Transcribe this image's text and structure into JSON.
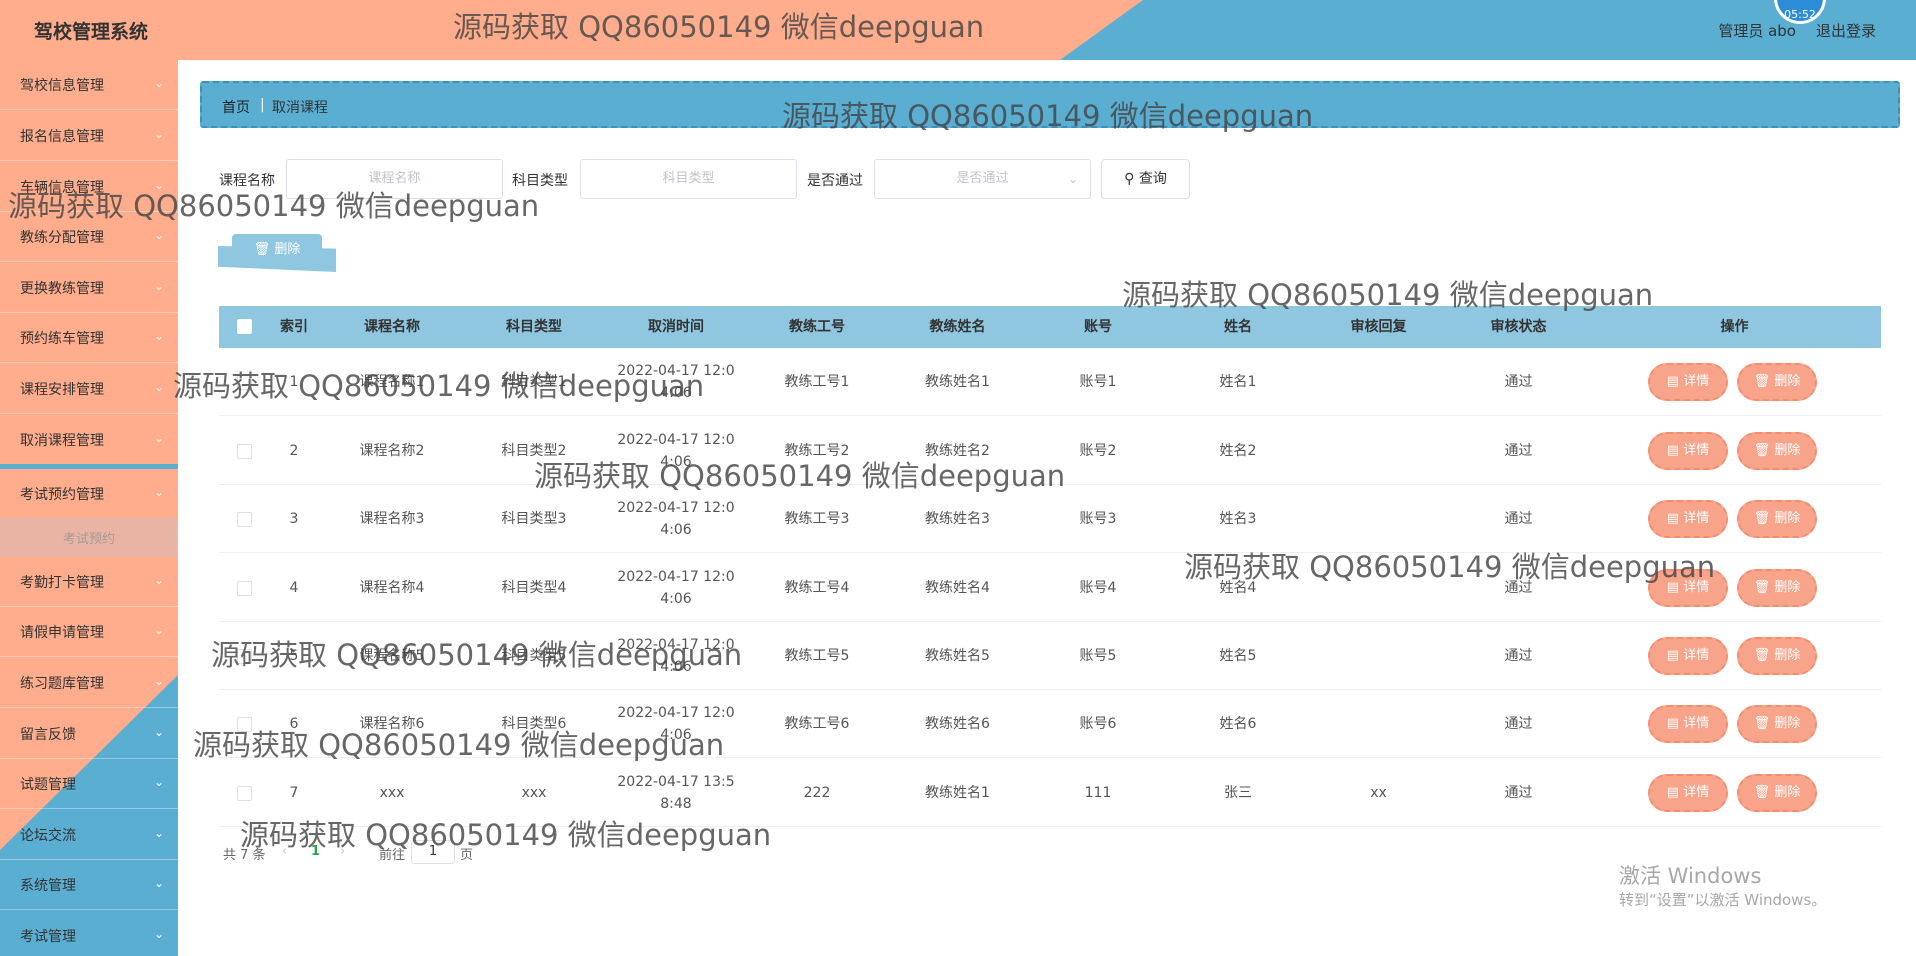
{
  "header": {
    "brand": "驾校管理系统",
    "user": "管理员 abo",
    "logout": "退出登录",
    "clock": "05:52"
  },
  "sidebar": {
    "items": [
      {
        "label": "驾校信息管理"
      },
      {
        "label": "报名信息管理"
      },
      {
        "label": "车辆信息管理"
      },
      {
        "label": "教练分配管理"
      },
      {
        "label": "更换教练管理"
      },
      {
        "label": "预约练车管理"
      },
      {
        "label": "课程安排管理"
      },
      {
        "label": "取消课程管理"
      },
      {
        "label": "考试预约管理"
      },
      {
        "label": "考勤打卡管理"
      },
      {
        "label": "请假申请管理"
      },
      {
        "label": "练习题库管理"
      },
      {
        "label": "留言反馈"
      },
      {
        "label": "试题管理"
      },
      {
        "label": "论坛交流"
      },
      {
        "label": "系统管理"
      },
      {
        "label": "考试管理"
      }
    ],
    "sub_item": "考试预约"
  },
  "breadcrumb": {
    "home": "首页",
    "separator": "|",
    "current": "取消课程"
  },
  "search": {
    "course_label": "课程名称",
    "course_placeholder": "课程名称",
    "subject_label": "科目类型",
    "subject_placeholder": "科目类型",
    "pass_label": "是否通过",
    "pass_placeholder": "是否通过",
    "query_button": "查询"
  },
  "toolbar": {
    "delete_button": "删除"
  },
  "table": {
    "columns": [
      "索引",
      "课程名称",
      "科目类型",
      "取消时间",
      "教练工号",
      "教练姓名",
      "账号",
      "姓名",
      "审核回复",
      "审核状态",
      "操作"
    ],
    "rows": [
      {
        "index": "1",
        "course": "课程名称1",
        "subject": "科目类型1",
        "time1": "2022-04-17 12:0",
        "time2": "4:06",
        "coach_no": "教练工号1",
        "coach_name": "教练姓名1",
        "account": "账号1",
        "name": "姓名1",
        "reply": "",
        "status": "通过"
      },
      {
        "index": "2",
        "course": "课程名称2",
        "subject": "科目类型2",
        "time1": "2022-04-17 12:0",
        "time2": "4:06",
        "coach_no": "教练工号2",
        "coach_name": "教练姓名2",
        "account": "账号2",
        "name": "姓名2",
        "reply": "",
        "status": "通过"
      },
      {
        "index": "3",
        "course": "课程名称3",
        "subject": "科目类型3",
        "time1": "2022-04-17 12:0",
        "time2": "4:06",
        "coach_no": "教练工号3",
        "coach_name": "教练姓名3",
        "account": "账号3",
        "name": "姓名3",
        "reply": "",
        "status": "通过"
      },
      {
        "index": "4",
        "course": "课程名称4",
        "subject": "科目类型4",
        "time1": "2022-04-17 12:0",
        "time2": "4:06",
        "coach_no": "教练工号4",
        "coach_name": "教练姓名4",
        "account": "账号4",
        "name": "姓名4",
        "reply": "",
        "status": "通过"
      },
      {
        "index": "5",
        "course": "课程名称5",
        "subject": "科目类型5",
        "time1": "2022-04-17 12:0",
        "time2": "4:06",
        "coach_no": "教练工号5",
        "coach_name": "教练姓名5",
        "account": "账号5",
        "name": "姓名5",
        "reply": "",
        "status": "通过"
      },
      {
        "index": "6",
        "course": "课程名称6",
        "subject": "科目类型6",
        "time1": "2022-04-17 12:0",
        "time2": "4:06",
        "coach_no": "教练工号6",
        "coach_name": "教练姓名6",
        "account": "账号6",
        "name": "姓名6",
        "reply": "",
        "status": "通过"
      },
      {
        "index": "7",
        "course": "xxx",
        "subject": "xxx",
        "time1": "2022-04-17 13:5",
        "time2": "8:48",
        "coach_no": "222",
        "coach_name": "教练姓名1",
        "account": "111",
        "name": "张三",
        "reply": "xx",
        "status": "通过"
      }
    ],
    "detail_button": "详情",
    "delete_button": "删除"
  },
  "pagination": {
    "total": "共 7 条",
    "current_page": "1",
    "goto_label": "前往",
    "goto_value": "1",
    "page_suffix": "页"
  },
  "watermark": "源码获取 QQ86050149 微信deepguan",
  "windows_notice": {
    "title": "激活 Windows",
    "subtitle": "转到“设置”以激活 Windows。"
  },
  "colors": {
    "peach": "#ffad8d",
    "blue": "#5aaed2",
    "table_header": "#8fc6e0",
    "action_button": "#f8a48b"
  }
}
